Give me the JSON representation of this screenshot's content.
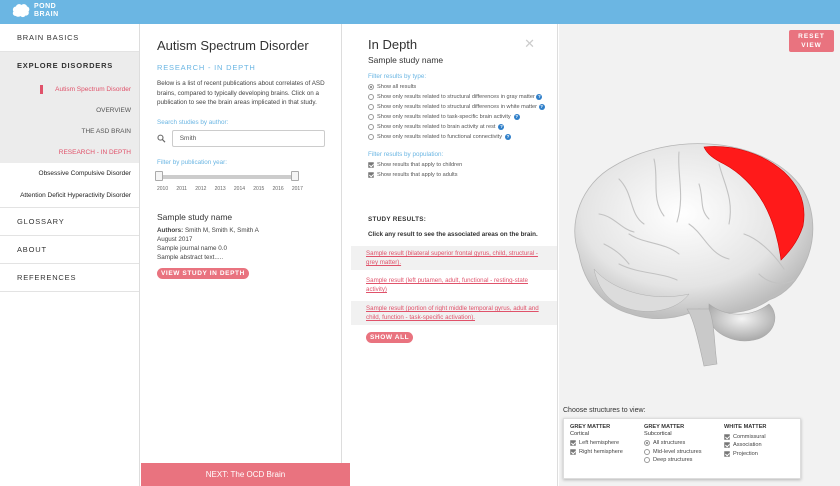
{
  "app": {
    "logo_line1": "POND",
    "logo_line2": "BRAIN"
  },
  "sidebar": {
    "brain_basics": "BRAIN BASICS",
    "explore": "EXPLORE DISORDERS",
    "sub": [
      "Autism Spectrum Disorder",
      "OVERVIEW",
      "THE ASD BRAIN",
      "RESEARCH - IN DEPTH"
    ],
    "disorders": [
      "Obsessive Compulsive Disorder",
      "Attention Deficit Hyperactivity Disorder"
    ],
    "glossary": "GLOSSARY",
    "about": "ABOUT",
    "references": "REFERENCES"
  },
  "research": {
    "title": "Autism Spectrum Disorder",
    "section": "RESEARCH - IN DEPTH",
    "intro": "Below is a list of recent publications about correlates of ASD brains, compared to typically developing brains. Click on a publication to see the brain areas implicated in that study.",
    "search_label": "Search studies by author:",
    "search_value": "Smith",
    "year_label": "Filter by publication year:",
    "years": [
      "2010",
      "2011",
      "2012",
      "2013",
      "2014",
      "2015",
      "2016",
      "2017"
    ],
    "study_title": "Sample study name",
    "authors_label": "Authors:",
    "authors": " Smith M, Smith K, Smith A",
    "date": "August 2017",
    "journal": "Sample journal name 0.0",
    "abstract": "Sample abstract text.....",
    "view_button": "VIEW STUDY IN DEPTH",
    "next": "NEXT: The OCD Brain"
  },
  "indepth": {
    "title": "In Depth",
    "close": "✕",
    "study_name": "Sample study name",
    "type_label": "Filter results by type:",
    "types": [
      "Show all results",
      "Show only results related to structural differences in gray matter",
      "Show only results related to structural differences in white matter",
      "Show only results related to task-specific brain activity",
      "Show only results related to brain activity at rest",
      "Show only results related to functional connectivity"
    ],
    "help": "?",
    "pop_label": "Filter results by population:",
    "populations": [
      "Show results that apply to children",
      "Show results that apply to adults"
    ],
    "results_header": "STUDY RESULTS:",
    "results_sub": "Click any result to see the associated areas on the brain.",
    "results": [
      "Sample result (bilateral superior frontal gyrus, child, structural - grey matter).",
      "Sample result (left putamen, adult, functional - resting-state activity)",
      "Sample result (portion of right middle temporal gyrus, adult and child, function - task-specific activation)."
    ],
    "show_all": "SHOW ALL"
  },
  "viewer": {
    "reset_line1": "RESET",
    "reset_line2": "VIEW",
    "choose_label": "Choose structures to view:",
    "grey_cortical_h": "GREY MATTER",
    "grey_cortical_sub": "Cortical",
    "cortical": [
      "Left hemisphere",
      "Right hemisphere"
    ],
    "grey_sub_h": "GREY MATTER",
    "grey_sub_sub": "Subcortical",
    "subcortical": [
      "All structures",
      "Mid-level structures",
      "Deep structures"
    ],
    "white_h": "WHITE MATTER",
    "white": [
      "Commissural",
      "Association",
      "Projection"
    ],
    "highlight_color": "#ff1a1a"
  }
}
